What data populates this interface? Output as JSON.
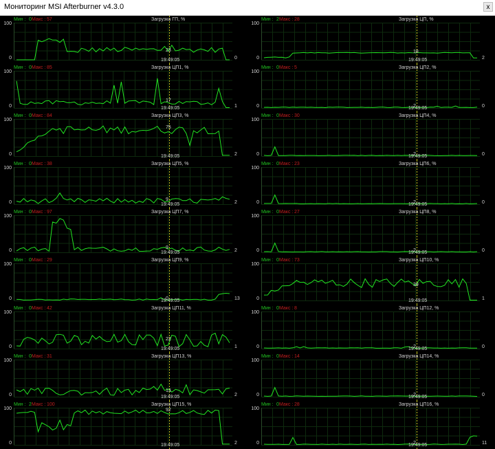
{
  "window": {
    "title": "Мониторинг MSI Afterburner v4.3.0",
    "close_label": "x"
  },
  "labels": {
    "min_prefix": "Мин : ",
    "max_prefix": "Макс : ",
    "time": "19:49:05",
    "y_max": "100",
    "y_min": "0"
  },
  "colors": {
    "background": "#000000",
    "grid": "#0e2a0e",
    "line": "#22e622",
    "cursor": "#c8c81e",
    "min_text": "#21c321",
    "max_text": "#c31f1f"
  },
  "panels": [
    {
      "name": "Загрузка ГП, %",
      "min": "0",
      "max": "57",
      "current": "0",
      "inline_value": "23",
      "level": 23,
      "profile": "gpu"
    },
    {
      "name": "Загрузка ЦП, %",
      "min": "2",
      "max": "28",
      "current": "2",
      "inline_value": "18",
      "level": 18,
      "profile": "steady"
    },
    {
      "name": "Загрузка ЦП1, %",
      "min": "0",
      "max": "85",
      "current": "1",
      "inline_value": "17",
      "level": 17,
      "profile": "spiky"
    },
    {
      "name": "Загрузка ЦП2, %",
      "min": "0",
      "max": "5",
      "current": "0",
      "inline_value": "2",
      "level": 1,
      "profile": "flat"
    },
    {
      "name": "Загрузка ЦП3, %",
      "min": "0",
      "max": "84",
      "current": "2",
      "inline_value": "75",
      "level": 75,
      "profile": "high"
    },
    {
      "name": "Загрузка ЦП4, %",
      "min": "0",
      "max": "30",
      "current": "0",
      "inline_value": "2",
      "level": 1,
      "profile": "flatspike"
    },
    {
      "name": "Загрузка ЦП5, %",
      "min": "0",
      "max": "38",
      "current": "2",
      "inline_value": "9",
      "level": 9,
      "profile": "noise"
    },
    {
      "name": "Загрузка ЦП6, %",
      "min": "0",
      "max": "23",
      "current": "0",
      "inline_value": "2",
      "level": 1,
      "profile": "flatspike"
    },
    {
      "name": "Загрузка ЦП7, %",
      "min": "0",
      "max": "97",
      "current": "2",
      "inline_value": "9",
      "level": 9,
      "profile": "earlyspike"
    },
    {
      "name": "Загрузка ЦП8, %",
      "min": "0",
      "max": "27",
      "current": "0",
      "inline_value": "2",
      "level": 1,
      "profile": "flatspike"
    },
    {
      "name": "Загрузка ЦП9, %",
      "min": "0",
      "max": "29",
      "current": "13",
      "inline_value": "0",
      "level": 2,
      "profile": "low"
    },
    {
      "name": "Загрузка ЦП10, %",
      "min": "0",
      "max": "73",
      "current": "1",
      "inline_value": "39",
      "level": 39,
      "profile": "mid"
    },
    {
      "name": "Загрузка ЦП11, %",
      "min": "0",
      "max": "42",
      "current": "1",
      "inline_value": "22",
      "level": 22,
      "profile": "noise"
    },
    {
      "name": "Загрузка ЦП12, %",
      "min": "0",
      "max": "8",
      "current": "0",
      "inline_value": "2",
      "level": 1,
      "profile": "flat"
    },
    {
      "name": "Загрузка ЦП13, %",
      "min": "0",
      "max": "31",
      "current": "2",
      "inline_value": "13",
      "level": 13,
      "profile": "noise"
    },
    {
      "name": "Загрузка ЦП14, %",
      "min": "0",
      "max": "14",
      "current": "0",
      "inline_value": "2",
      "level": 1,
      "profile": "flatspike"
    },
    {
      "name": "Загрузка ЦП15, %",
      "min": "2",
      "max": "100",
      "current": "2",
      "inline_value": "92",
      "level": 92,
      "profile": "top"
    },
    {
      "name": "Загрузка ЦП16, %",
      "min": "0",
      "max": "28",
      "current": "11",
      "inline_value": "2",
      "level": 1,
      "profile": "endspike"
    }
  ]
}
